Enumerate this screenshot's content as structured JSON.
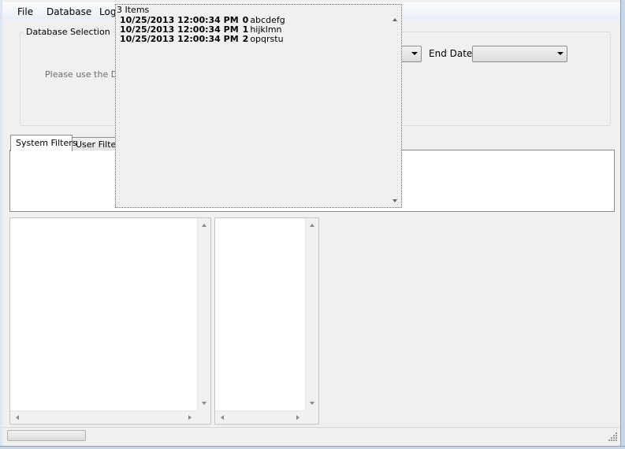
{
  "menu": {
    "file": "File",
    "database": "Database",
    "log": "Log"
  },
  "database_selection": {
    "title": "Database Selection",
    "instructions": "Please use the Dat",
    "end_date_label": "End Date",
    "start_date_value": "",
    "end_date_value": ""
  },
  "tabs": {
    "system": "System Filters",
    "user": "User Filters"
  },
  "popup": {
    "title": "3 Items",
    "items": [
      {
        "timestamp": "10/25/2013 12:00:34 PM",
        "index": "0",
        "text": "abcdefg"
      },
      {
        "timestamp": "10/25/2013 12:00:34 PM",
        "index": "1",
        "text": "hijklmn"
      },
      {
        "timestamp": "10/25/2013 12:00:34 PM",
        "index": "2",
        "text": "opqrstu"
      }
    ]
  },
  "status": {
    "progress": 0
  },
  "colors": {
    "background": "#f0f0f0",
    "border": "#898c95",
    "progress_fill": "#7bc45e"
  }
}
